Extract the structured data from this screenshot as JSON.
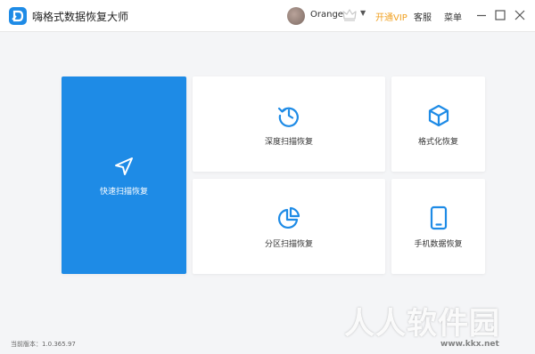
{
  "app": {
    "title": "嗨格式数据恢复大师",
    "version_label": "当前版本：1.0.365.97"
  },
  "header": {
    "user_name": "Orange",
    "vip_label": "开通VIP",
    "service_label": "客服",
    "menu_label": "菜单",
    "vip_color": "#f0a020"
  },
  "colors": {
    "accent": "#1e8be6",
    "background": "#f4f5f7",
    "card": "#ffffff"
  },
  "cards": [
    {
      "label": "快速扫描恢复",
      "icon": "navigation-arrow-icon",
      "selected": true
    },
    {
      "label": "深度扫描恢复",
      "icon": "history-clock-icon",
      "selected": false
    },
    {
      "label": "格式化恢复",
      "icon": "cube-icon",
      "selected": false
    },
    {
      "label": "分区扫描恢复",
      "icon": "pie-chart-icon",
      "selected": false
    },
    {
      "label": "手机数据恢复",
      "icon": "phone-icon",
      "selected": false
    }
  ],
  "watermark": {
    "text": "人人软件园",
    "url": "www.kkx.net"
  }
}
